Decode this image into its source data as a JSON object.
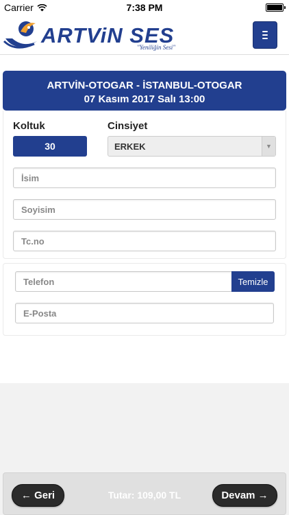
{
  "status_bar": {
    "carrier": "Carrier",
    "time": "7:38 PM"
  },
  "header": {
    "logo_text": "ARTViN SES",
    "logo_slogan": "\"Yeniliğin Sesi\"",
    "menu_icon": "hamburger-icon"
  },
  "trip": {
    "route": "ARTVİN-OTOGAR - İSTANBUL-OTOGAR",
    "datetime": "07 Kasım 2017 Salı 13:00"
  },
  "form": {
    "seat_label": "Koltuk",
    "seat_value": "30",
    "gender_label": "Cinsiyet",
    "gender_value": "ERKEK",
    "first_name_placeholder": "İsim",
    "last_name_placeholder": "Soyisim",
    "tc_placeholder": "Tc.no",
    "phone_placeholder": "Telefon",
    "clear_label": "Temizle",
    "email_placeholder": "E-Posta"
  },
  "footer": {
    "back_label": "← Geri",
    "total_text": "Tutar: 109,00 TL",
    "next_label": "Devam →"
  },
  "colors": {
    "brand": "#223f8f",
    "dark_button": "#2b2b2b"
  }
}
